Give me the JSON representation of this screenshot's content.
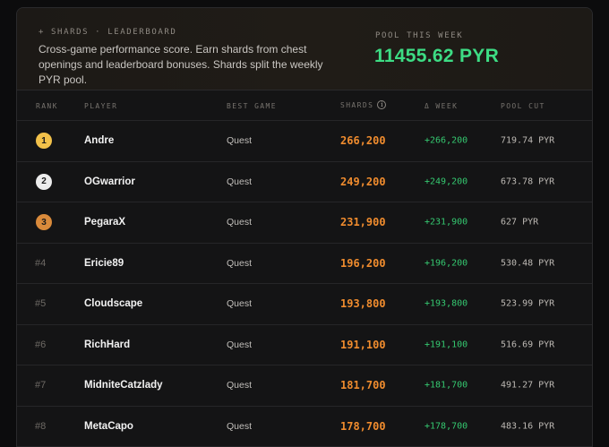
{
  "header": {
    "kicker": "+ SHARDS · LEADERBOARD",
    "description": "Cross-game performance score. Earn shards from chest openings and leaderboard bonuses. Shards split the weekly PYR pool.",
    "pool_label": "POOL THIS WEEK",
    "pool_value": "11455.62 PYR"
  },
  "columns": {
    "rank": "RANK",
    "player": "PLAYER",
    "best_game": "BEST GAME",
    "shards": "SHARDS",
    "week": "Δ WEEK",
    "pool_cut": "POOL CUT",
    "info_glyph": "i"
  },
  "colors": {
    "gold": "#f2c14a",
    "silver": "#ececec",
    "bronze": "#d98a3b",
    "shards": "#f08c2e",
    "positive": "#35c870",
    "pool": "#3ddc84"
  },
  "rows": [
    {
      "rank": "1",
      "badge": "gold",
      "player": "Andre",
      "game": "Quest",
      "shards": "266,200",
      "delta": "+266,200",
      "cut": "719.74 PYR"
    },
    {
      "rank": "2",
      "badge": "silver",
      "player": "OGwarrior",
      "game": "Quest",
      "shards": "249,200",
      "delta": "+249,200",
      "cut": "673.78 PYR"
    },
    {
      "rank": "3",
      "badge": "bronze",
      "player": "PegaraX",
      "game": "Quest",
      "shards": "231,900",
      "delta": "+231,900",
      "cut": "627 PYR"
    },
    {
      "rank": "#4",
      "badge": "",
      "player": "Ericie89",
      "game": "Quest",
      "shards": "196,200",
      "delta": "+196,200",
      "cut": "530.48 PYR"
    },
    {
      "rank": "#5",
      "badge": "",
      "player": "Cloudscape",
      "game": "Quest",
      "shards": "193,800",
      "delta": "+193,800",
      "cut": "523.99 PYR"
    },
    {
      "rank": "#6",
      "badge": "",
      "player": "RichHard",
      "game": "Quest",
      "shards": "191,100",
      "delta": "+191,100",
      "cut": "516.69 PYR"
    },
    {
      "rank": "#7",
      "badge": "",
      "player": "MidniteCatzlady",
      "game": "Quest",
      "shards": "181,700",
      "delta": "+181,700",
      "cut": "491.27 PYR"
    },
    {
      "rank": "#8",
      "badge": "",
      "player": "MetaCapo",
      "game": "Quest",
      "shards": "178,700",
      "delta": "+178,700",
      "cut": "483.16 PYR"
    }
  ]
}
